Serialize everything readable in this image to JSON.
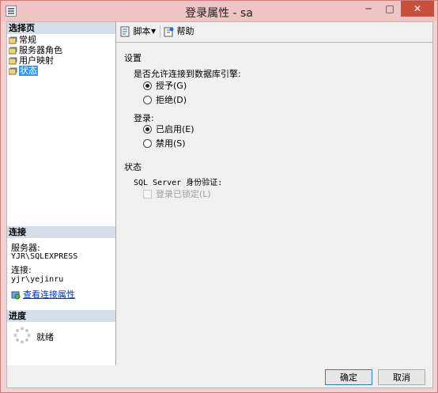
{
  "window": {
    "title": "登录属性 - sa",
    "min_label": "─",
    "max_label": "□",
    "close_label": "✕"
  },
  "left": {
    "select_page_header": "选择页",
    "pages": [
      {
        "label": "常规"
      },
      {
        "label": "服务器角色"
      },
      {
        "label": "用户映射"
      },
      {
        "label": "状态",
        "selected": true
      }
    ],
    "connection_header": "连接",
    "server_label": "服务器:",
    "server_value": "YJR\\SQLEXPRESS",
    "connection_label": "连接:",
    "connection_value": "yjr\\yejinru",
    "view_connection_link": "查看连接属性",
    "progress_header": "进度",
    "progress_status": "就绪"
  },
  "toolbar": {
    "script_label": "脚本",
    "help_label": "帮助"
  },
  "content": {
    "settings_heading": "设置",
    "db_engine_question": "是否允许连接到数据库引擎:",
    "grant_label": "授予(G)",
    "deny_label": "拒绝(D)",
    "login_heading": "登录:",
    "enabled_label": "已启用(E)",
    "disabled_label": "禁用(S)",
    "status_heading": "状态",
    "sql_auth_label": "SQL Server 身份验证:",
    "locked_label": "登录已锁定(L)",
    "db_engine_permission": "grant",
    "login_state": "enabled",
    "locked": false
  },
  "buttons": {
    "ok_label": "确定",
    "cancel_label": "取消"
  },
  "colors": {
    "titlebar": "#efc4c4",
    "close_button": "#c7503d",
    "selection": "#3399ff",
    "section_header": "#d4dde8",
    "link": "#0033cc"
  }
}
